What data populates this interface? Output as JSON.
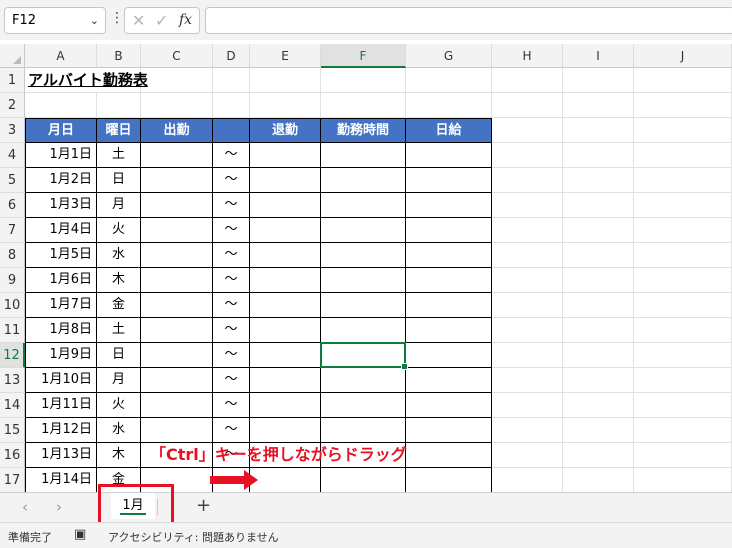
{
  "formula_bar": {
    "name_box": "F12",
    "cancel_icon": "✕",
    "enter_icon": "✓",
    "fx_label": "fx",
    "formula": ""
  },
  "columns": [
    "A",
    "B",
    "C",
    "D",
    "E",
    "F",
    "G",
    "H",
    "I",
    "J"
  ],
  "rows": [
    "1",
    "2",
    "3",
    "4",
    "5",
    "6",
    "7",
    "8",
    "9",
    "10",
    "11",
    "12",
    "13",
    "14",
    "15",
    "16",
    "17"
  ],
  "selected_cell": "F12",
  "sheet": {
    "title": "アルバイト勤務表",
    "headers": [
      "月日",
      "曜日",
      "出勤",
      "",
      "退勤",
      "勤務時間",
      "日給"
    ],
    "tilde": "～",
    "data_rows": [
      {
        "date": "1月1日",
        "day": "土"
      },
      {
        "date": "1月2日",
        "day": "日"
      },
      {
        "date": "1月3日",
        "day": "月"
      },
      {
        "date": "1月4日",
        "day": "火"
      },
      {
        "date": "1月5日",
        "day": "水"
      },
      {
        "date": "1月6日",
        "day": "木"
      },
      {
        "date": "1月7日",
        "day": "金"
      },
      {
        "date": "1月8日",
        "day": "土"
      },
      {
        "date": "1月9日",
        "day": "日"
      },
      {
        "date": "1月10日",
        "day": "月"
      },
      {
        "date": "1月11日",
        "day": "火"
      },
      {
        "date": "1月12日",
        "day": "水"
      },
      {
        "date": "1月13日",
        "day": "木"
      },
      {
        "date": "1月14日",
        "day": "金"
      }
    ]
  },
  "annotation": {
    "text": "「Ctrl」キーを押しながらドラッグ",
    "color": "#e81123"
  },
  "tabs": {
    "prev_icon": "‹",
    "next_icon": "›",
    "sheets": [
      "1月"
    ],
    "add_icon": "+"
  },
  "status": {
    "ready": "準備完了",
    "accessibility": "アクセシビリティ: 問題ありません"
  },
  "colors": {
    "header_fill": "#4472c4",
    "excel_green": "#107c41"
  }
}
